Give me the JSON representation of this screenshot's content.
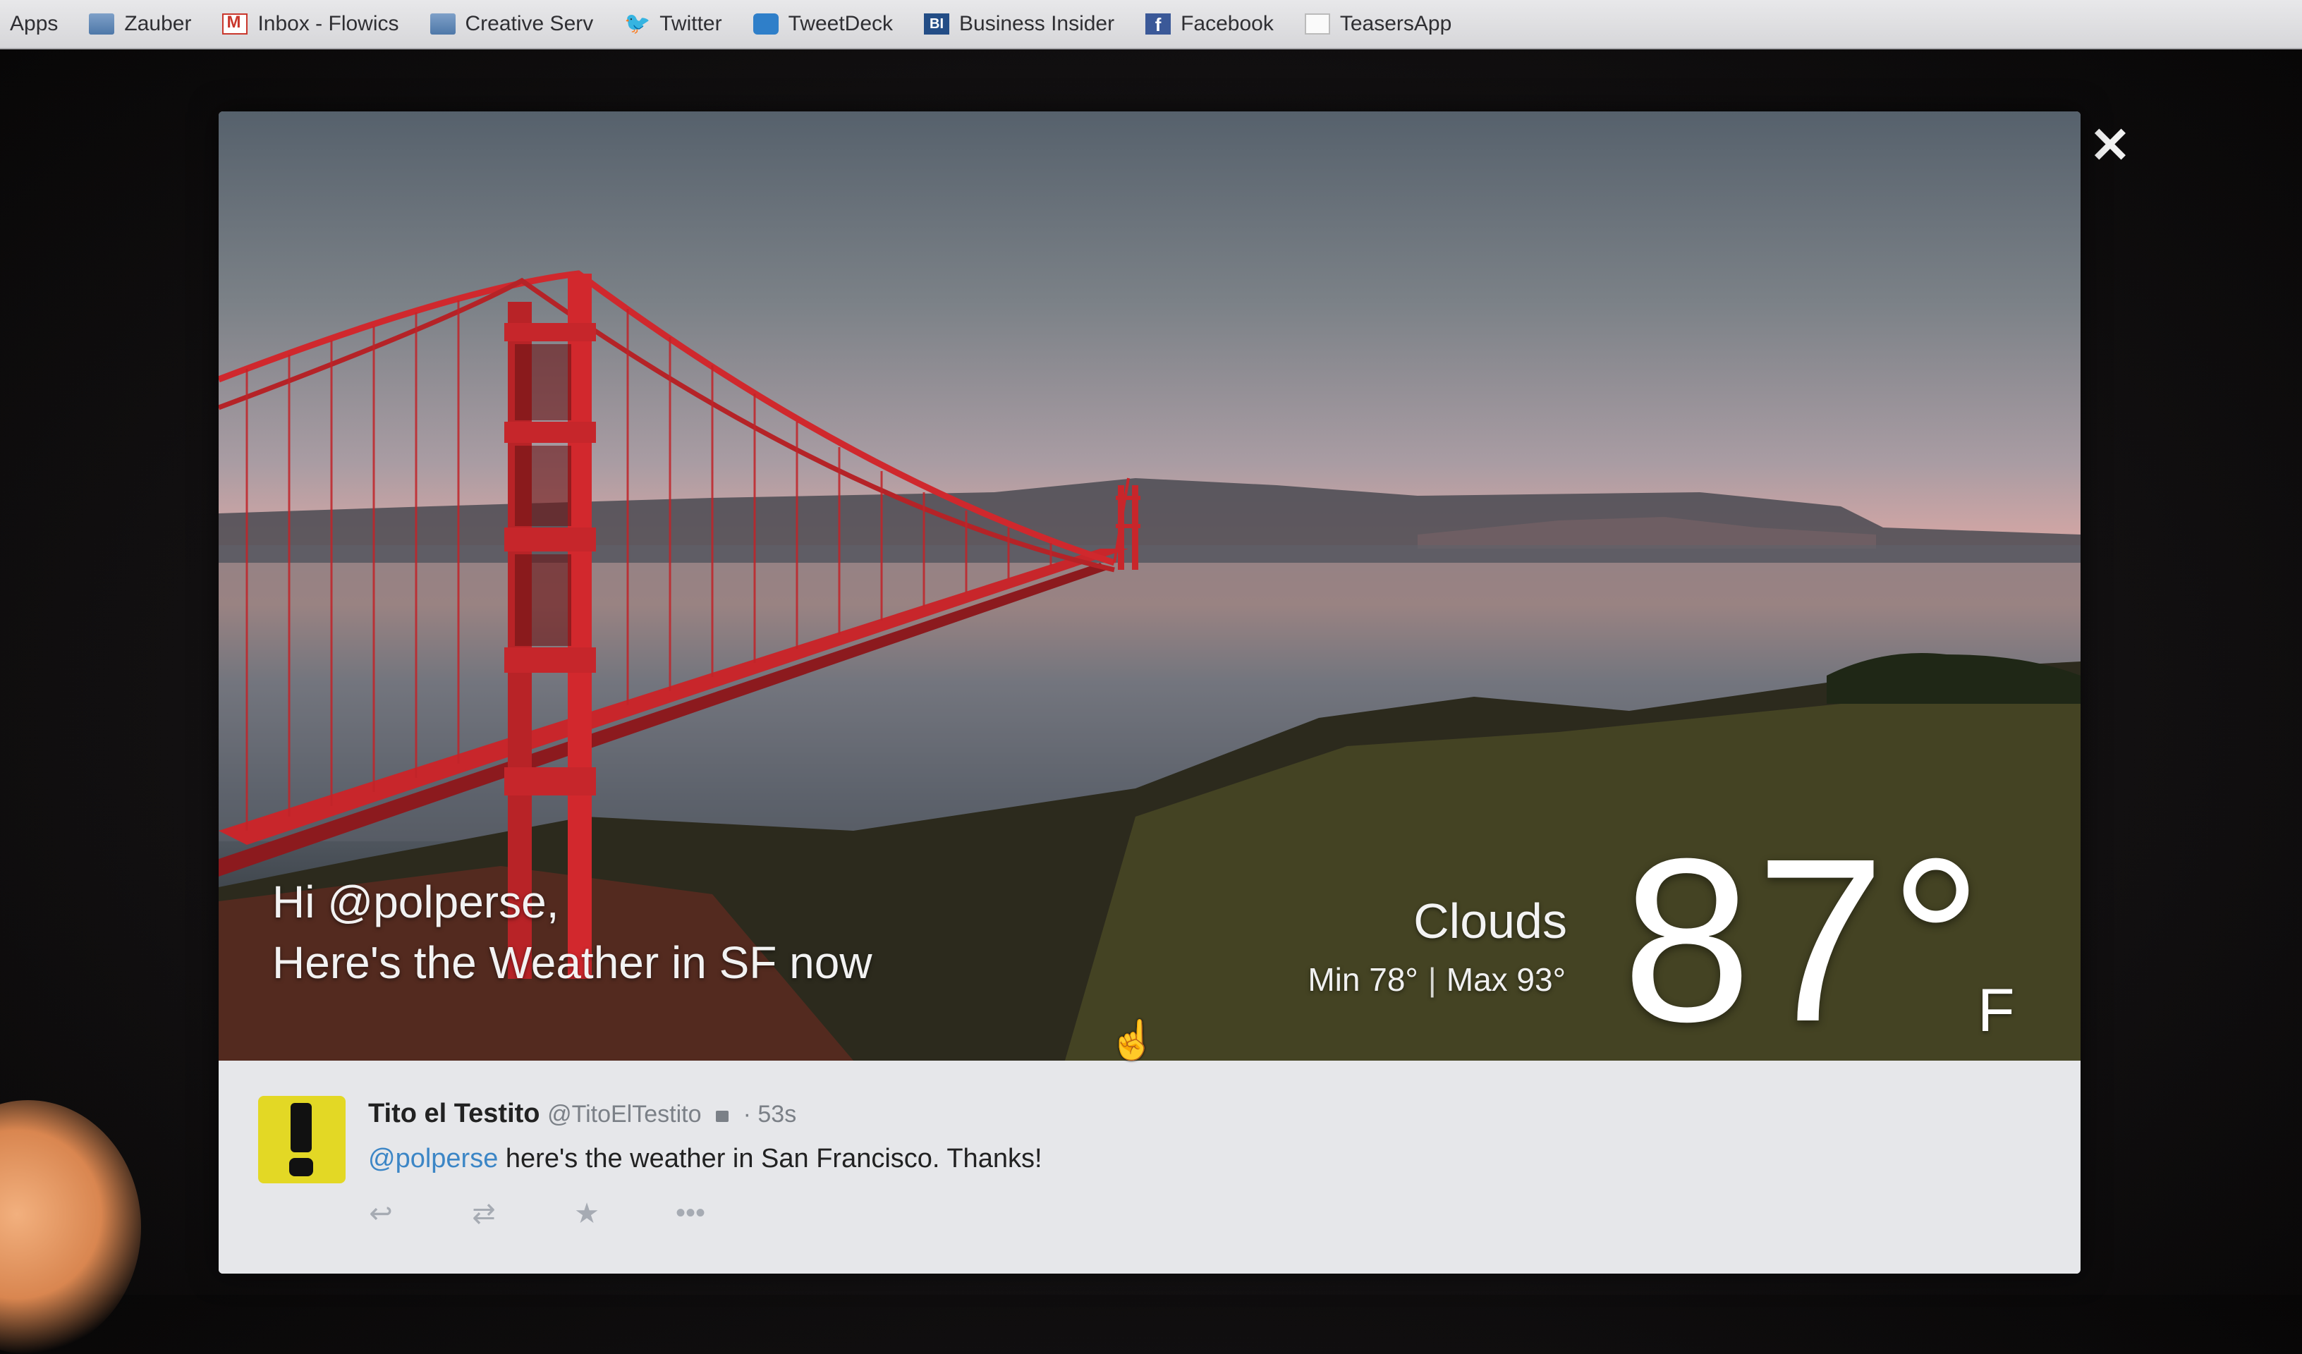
{
  "bookmarks": {
    "items": [
      {
        "label": "Apps",
        "icon": "apps-icon"
      },
      {
        "label": "Zauber",
        "icon": "folder-icon"
      },
      {
        "label": "Inbox - Flowics",
        "icon": "gmail-icon"
      },
      {
        "label": "Creative Serv",
        "icon": "folder-icon"
      },
      {
        "label": "Twitter",
        "icon": "twitter-icon"
      },
      {
        "label": "TweetDeck",
        "icon": "tweetdeck-icon"
      },
      {
        "label": "Business Insider",
        "icon": "business-insider-icon"
      },
      {
        "label": "Facebook",
        "icon": "facebook-icon"
      },
      {
        "label": "TeasersApp",
        "icon": "page-icon"
      }
    ]
  },
  "modal": {
    "close_glyph": "✕",
    "greeting_line1": "Hi @polperse,",
    "greeting_line2": "Here's the Weather in SF now",
    "condition": "Clouds",
    "min": "Min 78°",
    "separator": "|",
    "max": "Max 93°",
    "temperature": "87°",
    "unit": "F"
  },
  "tweet": {
    "name": "Tito el Testito",
    "handle": "@TitoElTestito",
    "time": "· 53s",
    "mention": "@polperse",
    "text": " here's the weather in San Francisco. Thanks!",
    "actions": [
      "reply-icon",
      "retweet-icon",
      "favorite-icon",
      "more-icon"
    ],
    "reply_glyph": "↩",
    "retweet_glyph": "⇄",
    "favorite_glyph": "★",
    "more_glyph": "•••"
  },
  "colors": {
    "bridge": "#c8262b",
    "mention": "#3c86c6",
    "avatar": "#e3d825"
  }
}
